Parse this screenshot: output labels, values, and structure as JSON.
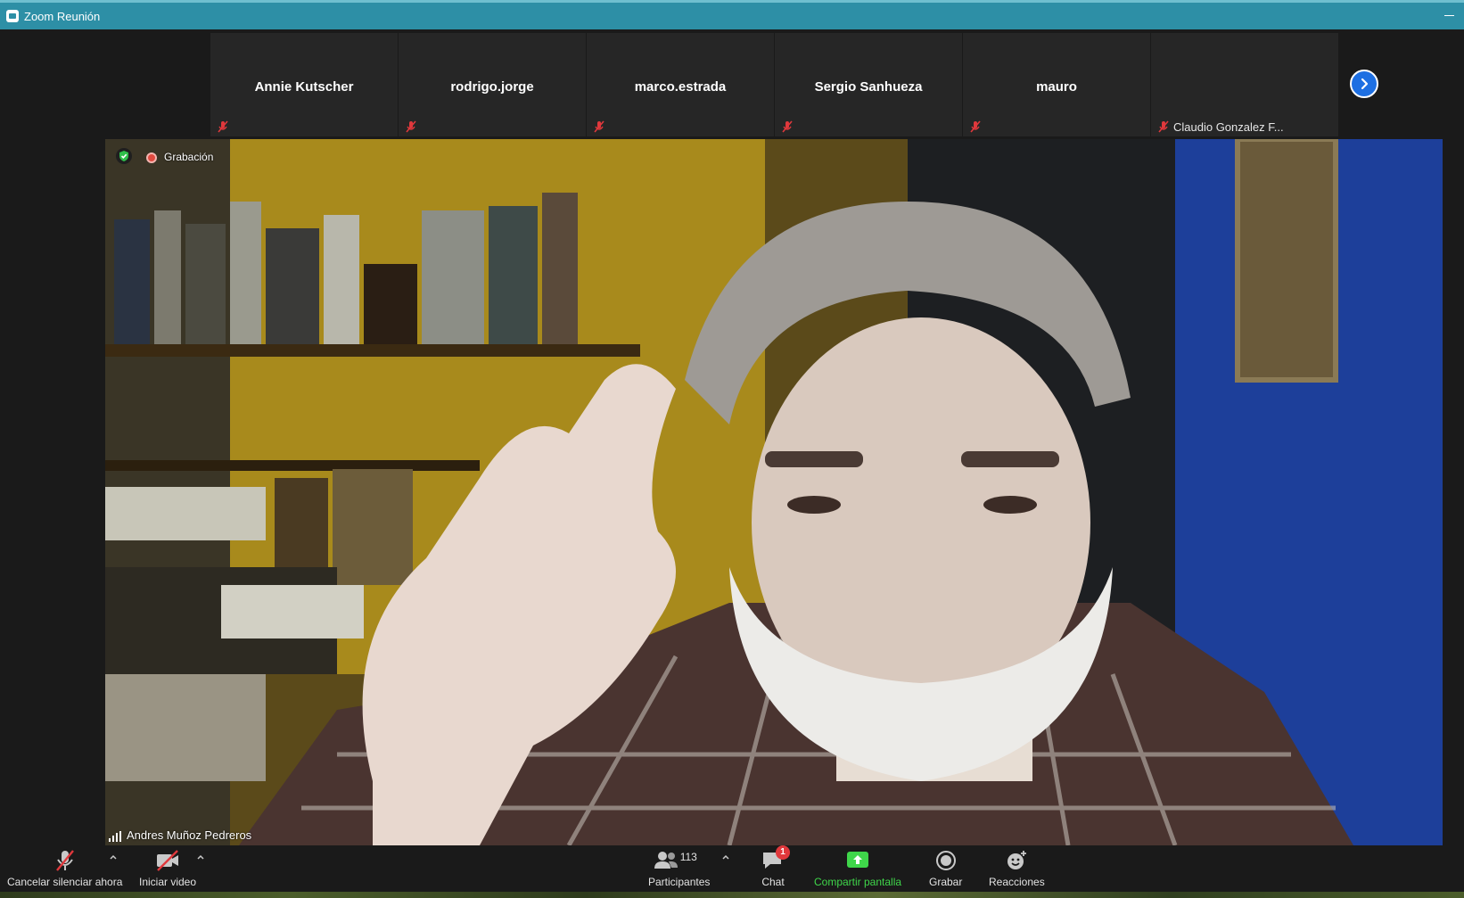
{
  "window": {
    "title": "Zoom Reunión"
  },
  "colors": {
    "titlebar": "#2d8fa6",
    "share_green": "#3fd64a",
    "muted_red": "#e0383c",
    "next_blue": "#1d6fe2"
  },
  "participants_strip": {
    "tiles": [
      {
        "name": "Annie Kutscher",
        "label": ""
      },
      {
        "name": "rodrigo.jorge",
        "label": ""
      },
      {
        "name": "marco.estrada",
        "label": ""
      },
      {
        "name": "Sergio Sanhueza",
        "label": ""
      },
      {
        "name": "mauro",
        "label": ""
      },
      {
        "name": "",
        "label": "Claudio Gonzalez F..."
      }
    ],
    "next_icon": "chevron-right-icon"
  },
  "main_video": {
    "recording_label": "Grabación",
    "speaker_name": "Andres Muñoz Pedreros"
  },
  "toolbar": {
    "unmute_label": "Cancelar silenciar ahora",
    "start_video_label": "Iniciar video",
    "participants_label": "Participantes",
    "participants_count": "113",
    "chat_label": "Chat",
    "chat_badge": "1",
    "share_label": "Compartir pantalla",
    "record_label": "Grabar",
    "reactions_label": "Reacciones"
  }
}
